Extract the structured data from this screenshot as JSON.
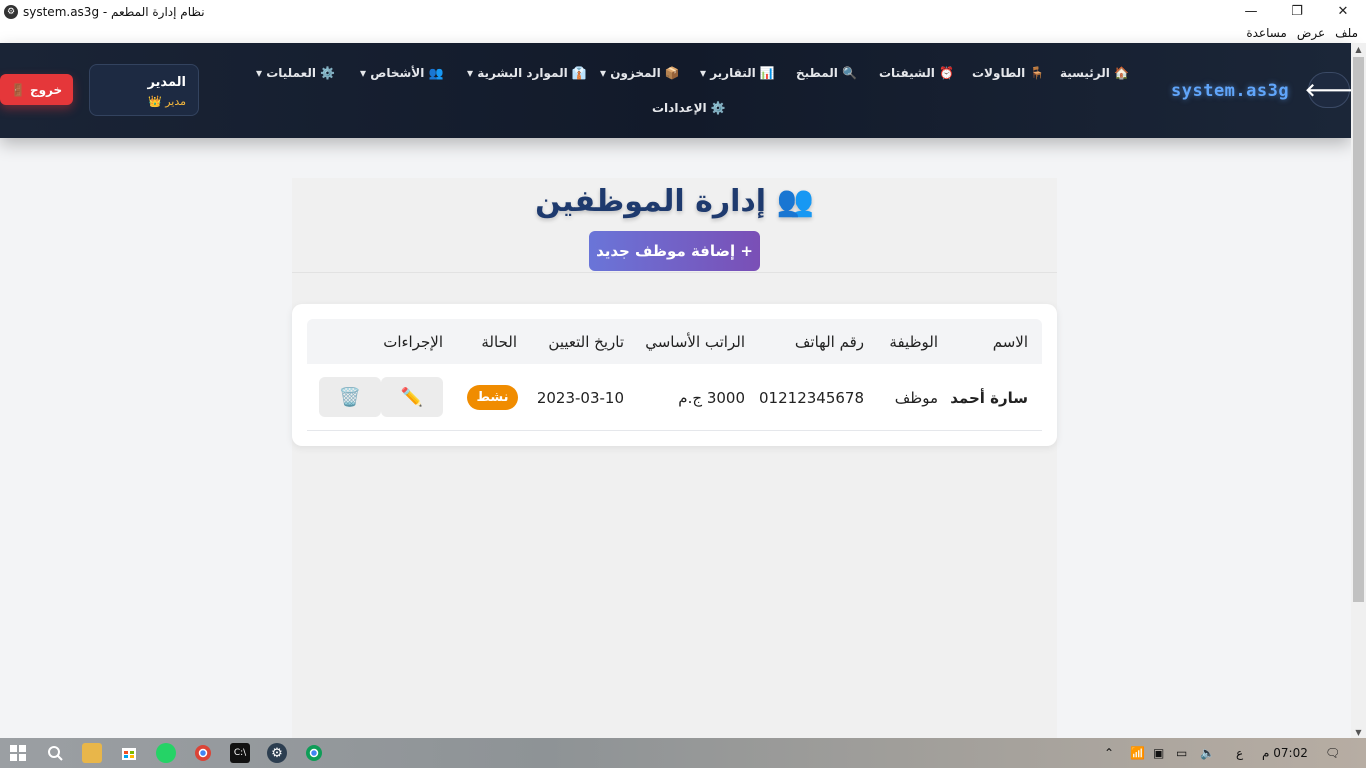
{
  "window": {
    "title": "system.as3g - نظام إدارة المطعم",
    "minimize": "—",
    "restore": "❐",
    "close": "✕"
  },
  "menu": [
    "ملف",
    "عرض",
    "مساعدة"
  ],
  "header": {
    "brand": "system.as3g",
    "back_icon": "arrow-left-icon",
    "nav": [
      {
        "label": "🏠 الرئيسية"
      },
      {
        "label": "🪑 الطاولات"
      },
      {
        "label": "⏰ الشيفتات"
      },
      {
        "label": "🔍 المطبخ"
      },
      {
        "label": "📊 التقارير ▾"
      },
      {
        "label": "📦 المخزون ▾"
      },
      {
        "label": "👔 الموارد البشرية ▾"
      },
      {
        "label": "👥 الأشخاص ▾"
      },
      {
        "label": "⚙️ العمليات ▾"
      },
      {
        "label": "⚙️ الإعدادات"
      }
    ],
    "user": {
      "name": "المدير",
      "role": "👑 مدير"
    },
    "logout_label": "🚪 خروج"
  },
  "page": {
    "title": "👥 إدارة الموظفين",
    "add_button": "+ إضافة موظف جديد"
  },
  "table": {
    "columns": [
      "الاسم",
      "الوظيفة",
      "رقم الهاتف",
      "الراتب الأساسي",
      "تاريخ التعيين",
      "الحالة",
      "الإجراءات"
    ],
    "rows": [
      {
        "name": "سارة أحمد",
        "job": "موظف",
        "phone": "01212345678",
        "salary": "3000 ج.م",
        "hire_date": "2023-03-10",
        "status": "نشط",
        "actions": {
          "edit": "✏️",
          "delete": "🗑️"
        }
      }
    ]
  },
  "taskbar": {
    "clock": "07:02 م",
    "lang": "ع"
  },
  "colors": {
    "header_bg": "#121a2a",
    "brand": "#60a5fa",
    "logout": "#e5373a",
    "status_active": "#f08c00",
    "add_button_start": "#6a75d8",
    "add_button_end": "#7a4fb6"
  }
}
